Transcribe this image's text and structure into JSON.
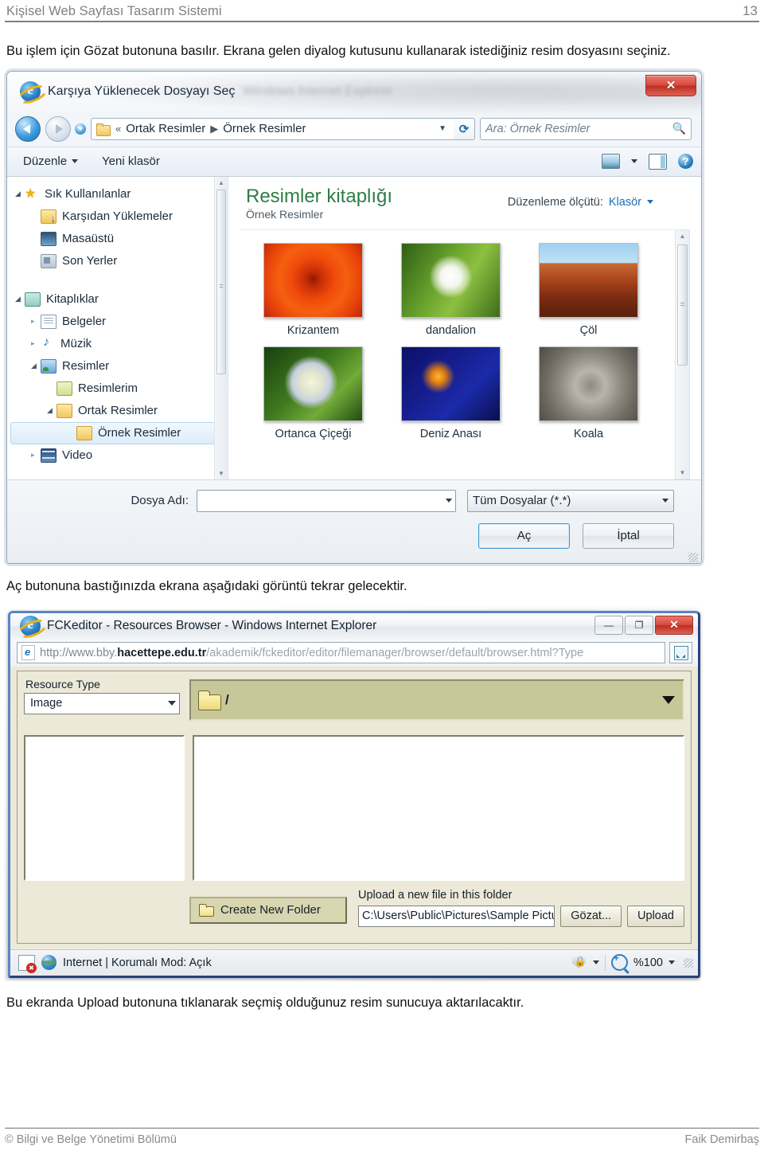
{
  "document": {
    "header_title": "Kişisel Web Sayfası Tasarım Sistemi",
    "page_number": "13",
    "paragraph_1": "Bu işlem için Gözat butonuna basılır. Ekrana gelen diyalog kutusunu kullanarak istediğiniz resim dosyasını seçiniz.",
    "paragraph_2": "Aç butonuna bastığınızda ekrana aşağıdaki görüntü tekrar gelecektir.",
    "paragraph_3": "Bu ekranda Upload butonuna tıklanarak seçmiş olduğunuz resim sunucuya aktarılacaktır.",
    "footer_left": "© Bilgi ve Belge Yönetimi Bölümü",
    "footer_right": "Faik Demirbaş"
  },
  "file_dialog": {
    "title": "Karşıya Yüklenecek Dosyayı Seç",
    "ghost_title": "Windows Internet Explorer",
    "close_label": "✕",
    "breadcrumb": {
      "prefix": "«",
      "items": [
        "Ortak Resimler",
        "Örnek Resimler"
      ],
      "separator": "▶"
    },
    "search_placeholder": "Ara: Örnek Resimler",
    "toolbar": {
      "organize": "Düzenle",
      "new_folder": "Yeni klasör"
    },
    "nav_tree": [
      {
        "label": "Sık Kullanılanlar",
        "icon": "star-icon",
        "indent": 0,
        "expander": "open",
        "selected": false
      },
      {
        "label": "Karşıdan Yüklemeler",
        "icon": "downloads-icon",
        "indent": 1,
        "expander": "none",
        "selected": false
      },
      {
        "label": "Masaüstü",
        "icon": "desktop-icon",
        "indent": 1,
        "expander": "none",
        "selected": false
      },
      {
        "label": "Son Yerler",
        "icon": "recent-icon",
        "indent": 1,
        "expander": "none",
        "selected": false
      },
      {
        "label": "Kitaplıklar",
        "icon": "libraries-icon",
        "indent": 0,
        "expander": "open",
        "selected": false
      },
      {
        "label": "Belgeler",
        "icon": "documents-icon",
        "indent": 1,
        "expander": "closed",
        "selected": false
      },
      {
        "label": "Müzik",
        "icon": "music-icon",
        "indent": 1,
        "expander": "closed",
        "selected": false
      },
      {
        "label": "Resimler",
        "icon": "pictures-icon",
        "indent": 1,
        "expander": "open",
        "selected": false
      },
      {
        "label": "Resimlerim",
        "icon": "my-pictures-icon",
        "indent": 2,
        "expander": "none",
        "selected": false
      },
      {
        "label": "Ortak Resimler",
        "icon": "folder-icon",
        "indent": 2,
        "expander": "open",
        "selected": false
      },
      {
        "label": "Örnek Resimler",
        "icon": "folder-icon",
        "indent": 3,
        "expander": "none",
        "selected": true
      },
      {
        "label": "Video",
        "icon": "video-icon",
        "indent": 1,
        "expander": "closed",
        "selected": false
      }
    ],
    "library": {
      "title": "Resimler kitaplığı",
      "subtitle": "Örnek Resimler",
      "arrange_label": "Düzenleme ölçütü:",
      "arrange_value": "Klasör"
    },
    "files": [
      {
        "name": "Krizantem",
        "thumb": "krizantem"
      },
      {
        "name": "dandalion",
        "thumb": "dandelion"
      },
      {
        "name": "Çöl",
        "thumb": "col"
      },
      {
        "name": "Ortanca Çiçeği",
        "thumb": "ortanca"
      },
      {
        "name": "Deniz Anası",
        "thumb": "denizanasi"
      },
      {
        "name": "Koala",
        "thumb": "koala"
      }
    ],
    "footer": {
      "filename_label": "Dosya Adı:",
      "filename_value": "",
      "filter_value": "Tüm Dosyalar (*.*)",
      "open_button": "Aç",
      "cancel_button": "İptal"
    }
  },
  "browser_window": {
    "title": "FCKeditor - Resources Browser - Windows Internet Explorer",
    "minimize_label": "—",
    "maximize_label": "❐",
    "close_label": "✕",
    "url": {
      "scheme": "http://www.bby.",
      "domain": "hacettepe.edu.tr",
      "path": "/akademik/fckeditor/editor/filemanager/browser/default/browser.html?Type"
    },
    "resource_type": {
      "label": "Resource Type",
      "value": "Image"
    },
    "folder_path": "/",
    "create_folder_button": "Create New Folder",
    "upload": {
      "label": "Upload a new file in this folder",
      "path_value": "C:\\Users\\Public\\Pictures\\Sample Picture",
      "browse_button": "Gözat...",
      "upload_button": "Upload"
    },
    "status_bar": {
      "zone_text": "Internet | Korumalı Mod: Açık",
      "zoom_level": "%100"
    }
  }
}
